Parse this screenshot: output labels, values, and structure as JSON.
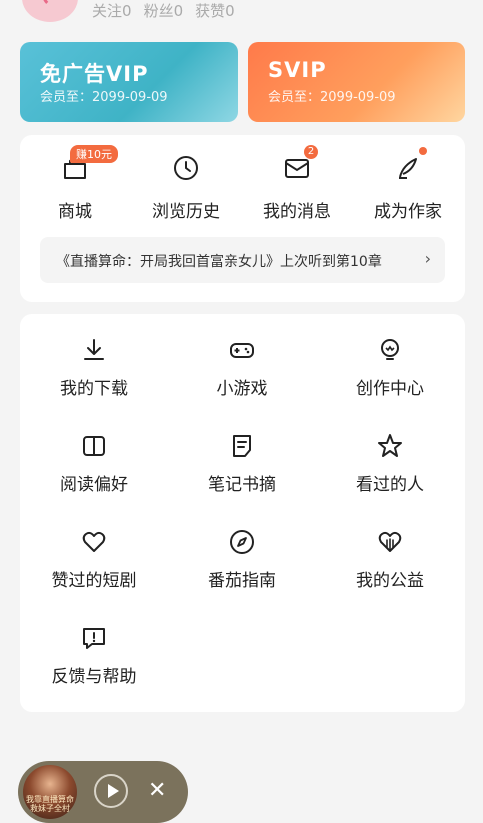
{
  "profile": {
    "stats": [
      {
        "label": "关注",
        "value": "0"
      },
      {
        "label": "粉丝",
        "value": "0"
      },
      {
        "label": "获赞",
        "value": "0"
      }
    ]
  },
  "vip_cards": [
    {
      "title": "免广告VIP",
      "subtitle": "会员至：2099-09-09"
    },
    {
      "title": "SVIP",
      "subtitle": "会员至：2099-09-09"
    }
  ],
  "quick_actions": [
    {
      "label": "商城",
      "icon": "bag-icon",
      "badge": "赚10元"
    },
    {
      "label": "浏览历史",
      "icon": "clock-icon"
    },
    {
      "label": "我的消息",
      "icon": "mail-icon",
      "badge": "2"
    },
    {
      "label": "成为作家",
      "icon": "quill-icon"
    }
  ],
  "recent_reading": {
    "text": "《直播算命：开局我回首富亲女儿》上次听到第10章",
    "chevron": "›"
  },
  "grid": [
    {
      "label": "我的下载",
      "icon": "download-icon"
    },
    {
      "label": "小游戏",
      "icon": "gamepad-icon"
    },
    {
      "label": "创作中心",
      "icon": "bulb-icon"
    },
    {
      "label": "阅读偏好",
      "icon": "book-icon"
    },
    {
      "label": "笔记书摘",
      "icon": "note-icon"
    },
    {
      "label": "看过的人",
      "icon": "star-icon"
    },
    {
      "label": "赞过的短剧",
      "icon": "heart-icon"
    },
    {
      "label": "番茄指南",
      "icon": "compass-icon"
    },
    {
      "label": "我的公益",
      "icon": "charity-heart-icon"
    },
    {
      "label": "反馈与帮助",
      "icon": "feedback-icon"
    }
  ],
  "player": {
    "cover_text": "我靠直播算命救妹子全村",
    "close": "✕"
  },
  "colors": {
    "accent": "#f36b3f",
    "vip_teal": "#3fb3c6",
    "svip_orange": "#ff7a4a"
  }
}
